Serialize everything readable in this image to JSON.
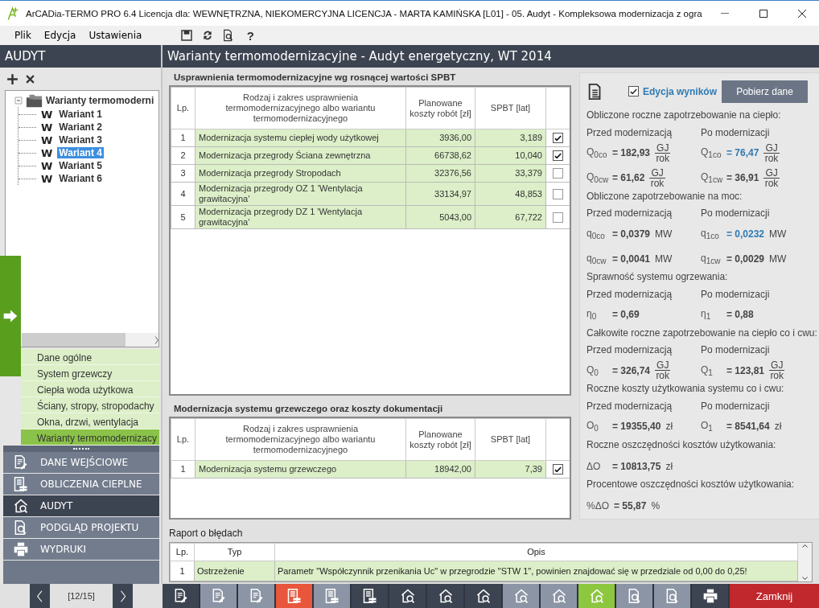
{
  "window": {
    "title": "ArCADia-TERMO PRO 6.4 Licencja dla: WEWNĘTRZNA, NIEKOMERCYJNA LICENCJA - MARTA KAMIŃSKA [L01] - 05. Audyt - Kompleksowa modernizacja z ogra"
  },
  "menu": [
    "Plik",
    "Edycja",
    "Ustawienia"
  ],
  "toolbar": {
    "help": "?"
  },
  "sidebar": {
    "title": "AUDYT",
    "tree": {
      "label": "Warianty termomoderni",
      "expanded": true,
      "children": [
        {
          "badge": "W",
          "label": "Wariant 1",
          "selected": false
        },
        {
          "badge": "W",
          "label": "Wariant 2",
          "selected": false
        },
        {
          "badge": "W",
          "label": "Wariant 3",
          "selected": false
        },
        {
          "badge": "W",
          "label": "Wariant 4",
          "selected": true
        },
        {
          "badge": "W",
          "label": "Wariant 5",
          "selected": false
        },
        {
          "badge": "W",
          "label": "Wariant 6",
          "selected": false
        }
      ]
    },
    "sections": [
      {
        "label": "Dane ogólne",
        "selected": false
      },
      {
        "label": "System grzewczy",
        "selected": false
      },
      {
        "label": "Ciepła woda użytkowa",
        "selected": false
      },
      {
        "label": "Ściany, stropy, stropodachy",
        "selected": false
      },
      {
        "label": "Okna, drzwi, wentylacja",
        "selected": false
      },
      {
        "label": "Warianty termomodernizacy",
        "selected": true
      }
    ],
    "modules": [
      {
        "kind": "edit",
        "label": "DANE WEJŚCIOWE",
        "selected": false
      },
      {
        "kind": "table",
        "label": "OBLICZENIA CIEPLNE",
        "selected": false
      },
      {
        "kind": "audit",
        "label": "AUDYT",
        "selected": true
      },
      {
        "kind": "preview",
        "label": "PODGLĄD PROJEKTU",
        "selected": false
      },
      {
        "kind": "print",
        "label": "WYDRUKI",
        "selected": false
      }
    ],
    "pager": "[12/15]"
  },
  "content": {
    "title": "Warianty termomodernizacyjne - Audyt energetyczny, WT 2014",
    "tables": [
      {
        "title": "Usprawnienia termomodernizacyjne wg rosnącej wartości SPBT",
        "columns": [
          "Lp.",
          "Rodzaj i zakres usprawnienia termomodernizacyjnego albo wariantu termomodernizacyjnego",
          "Planowane koszty robót [zł]",
          "SPBT [lat]"
        ],
        "rows": [
          {
            "lp": "1",
            "name": "Modernizacja systemu ciepłej wody użytkowej",
            "cost": "3936,00",
            "spbt": "3,189",
            "checked": true
          },
          {
            "lp": "2",
            "name": "Modernizacja przegrody Ściana zewnętrzna",
            "cost": "66738,62",
            "spbt": "10,040",
            "checked": true
          },
          {
            "lp": "3",
            "name": "Modernizacja przegrody Stropodach",
            "cost": "32376,56",
            "spbt": "33,379",
            "checked": false
          },
          {
            "lp": "4",
            "name": "Modernizacja przegrody OZ 1 'Wentylacja grawitacyjna'",
            "cost": "33134,97",
            "spbt": "48,853",
            "checked": false
          },
          {
            "lp": "5",
            "name": "Modernizacja przegrody DZ 1 'Wentylacja grawitacyjna'",
            "cost": "5043,00",
            "spbt": "67,722",
            "checked": false
          }
        ]
      },
      {
        "title": "Modernizacja systemu grzewczego oraz koszty dokumentacji",
        "columns": [
          "Lp.",
          "Rodzaj i zakres usprawnienia termomodernizacyjnego albo wariantu termomodernizacyjnego",
          "Planowane koszty robót [zł]",
          "SPBT [lat]"
        ],
        "rows": [
          {
            "lp": "1",
            "name": "Modernizacja systemu grzewczego",
            "cost": "18942,00",
            "spbt": "7,39",
            "checked": true
          }
        ]
      }
    ],
    "results": {
      "edit_checkbox": {
        "label": "Edycja wyników",
        "checked": true
      },
      "fetch_button": "Pobierz dane",
      "groups": [
        {
          "title": "Obliczone roczne zapotrzebowanie na ciepło:",
          "before_label": "Przed modernizacją",
          "after_label": "Po modernizacji",
          "rows": [
            [
              {
                "symbol": "Q$_{0co}$",
                "value": "= 182,93",
                "unit": [
                  "GJ",
                  "rok"
                ],
                "highlighted": false
              },
              {
                "symbol": "Q$_{1co}$",
                "value": "= 76,47",
                "unit": [
                  "GJ",
                  "rok"
                ],
                "highlighted": true
              }
            ],
            [
              {
                "symbol": "Q$_{0cw}$",
                "value": "= 61,62",
                "unit": [
                  "GJ",
                  "rok"
                ],
                "highlighted": false
              },
              {
                "symbol": "Q$_{1cw}$",
                "value": "= 36,91",
                "unit": [
                  "GJ",
                  "rok"
                ],
                "highlighted": false
              }
            ]
          ]
        },
        {
          "title": "Obliczone zapotrzebowanie na moc:",
          "before_label": "Przed modernizacją",
          "after_label": "Po modernizacji",
          "rows": [
            [
              {
                "symbol": "q$_{0co}$",
                "value": "= 0,0379",
                "unit": "MW",
                "highlighted": false
              },
              {
                "symbol": "q$_{1co}$",
                "value": "= 0,0232",
                "unit": "MW",
                "highlighted": true
              }
            ],
            [
              {
                "symbol": "q$_{0cw}$",
                "value": "= 0,0041",
                "unit": "MW",
                "highlighted": false
              },
              {
                "symbol": "q$_{1cw}$",
                "value": "= 0,0029",
                "unit": "MW",
                "highlighted": false
              }
            ]
          ]
        },
        {
          "title": "Sprawność systemu ogrzewania:",
          "before_label": "Przed modernizacją",
          "after_label": "Po modernizacji",
          "rows": [
            [
              {
                "symbol": "η$_{0}$",
                "value": "= 0,69",
                "highlighted": false
              },
              {
                "symbol": "η$_{1}$",
                "value": "= 0,88",
                "highlighted": false
              }
            ]
          ]
        },
        {
          "title": "Całkowite roczne zapotrzebowanie na ciepło co i cwu:",
          "before_label": "Przed modernizacją",
          "after_label": "Po modernizacji",
          "rows": [
            [
              {
                "symbol": "Q$_{0}$",
                "value": "= 326,74",
                "unit": [
                  "GJ",
                  "rok"
                ],
                "highlighted": false
              },
              {
                "symbol": "Q$_{1}$",
                "value": "= 123,81",
                "unit": [
                  "GJ",
                  "rok"
                ],
                "highlighted": false
              }
            ]
          ]
        },
        {
          "title": "Roczne koszty użytkowania systemu co i cwu:",
          "before_label": "Przed modernizacją",
          "after_label": "Po modernizacji",
          "rows": [
            [
              {
                "symbol": "O$_{0}$",
                "value": "= 19355,40",
                "unit": "zł",
                "highlighted": false
              },
              {
                "symbol": "O$_{1}$",
                "value": "= 8541,64",
                "unit": "zł",
                "highlighted": false
              }
            ]
          ]
        },
        {
          "title": "Roczne oszczędności kosztów użytkowania:",
          "rows": [
            [
              {
                "symbol": "ΔO",
                "value": "= 10813,75",
                "unit": "zł",
                "highlighted": false
              }
            ]
          ]
        },
        {
          "title": "Procentowe oszczędności kosztów użytkowania:",
          "rows": [
            [
              {
                "symbol": "%ΔO",
                "value": "= 55,87",
                "unit": "%",
                "highlighted": false
              }
            ]
          ]
        }
      ]
    },
    "error_report": {
      "title": "Raport o błędach",
      "columns": [
        "Lp.",
        "Typ",
        "Opis"
      ],
      "rows": [
        {
          "lp": "1",
          "type": "Ostrzeżenie",
          "description": "Parametr \"Współczynnik przenikania Uc\" w przegrodzie \"STW 1\", powinien znajdować się w przedziale od 0,00 do 0,25!"
        }
      ]
    }
  },
  "bottom_bar": {
    "buttons": [
      {
        "kind": "edit",
        "color": "#3d4451"
      },
      {
        "kind": "edit",
        "color": "#8c95a5"
      },
      {
        "kind": "edit",
        "color": "#8c95a5"
      },
      {
        "kind": "table",
        "color": "#e8563b"
      },
      {
        "kind": "table",
        "color": "#8c95a5"
      },
      {
        "kind": "table",
        "color": "#3d4451"
      },
      {
        "kind": "audit",
        "color": "#3d4451"
      },
      {
        "kind": "audit",
        "color": "#3d4451"
      },
      {
        "kind": "audit",
        "color": "#3d4451"
      },
      {
        "kind": "audit",
        "color": "#8c95a5"
      },
      {
        "kind": "audit",
        "color": "#8c95a5"
      },
      {
        "kind": "audit",
        "color": "#8dc63f"
      },
      {
        "kind": "preview",
        "color": "#8c95a5"
      },
      {
        "kind": "preview",
        "color": "#8c95a5"
      },
      {
        "kind": "print",
        "color": "#3d4451"
      }
    ],
    "close": "Zamknij"
  }
}
